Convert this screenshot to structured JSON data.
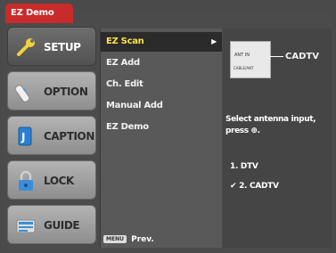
{
  "window": {
    "title": "EZ Demo"
  },
  "left_menu": {
    "items": [
      {
        "label": "SETUP",
        "icon": "wrench-icon",
        "active": true
      },
      {
        "label": "OPTION",
        "icon": "remote-icon",
        "active": false
      },
      {
        "label": "CAPTION",
        "icon": "caption-icon",
        "active": false
      },
      {
        "label": "LOCK",
        "icon": "padlock-icon",
        "active": false
      },
      {
        "label": "GUIDE",
        "icon": "guide-icon",
        "active": false
      }
    ]
  },
  "submenu": {
    "items": [
      {
        "label": "EZ Scan",
        "selected": true
      },
      {
        "label": "EZ Add",
        "selected": false
      },
      {
        "label": "Ch. Edit",
        "selected": false
      },
      {
        "label": "Manual Add",
        "selected": false
      },
      {
        "label": "EZ Demo",
        "selected": false
      }
    ],
    "arrow": "▶",
    "prev_key": "MENU",
    "prev_label": "Prev."
  },
  "info_panel": {
    "antenna_text_top": "ANT IN",
    "antenna_text_bottom": "CABLE/ANT",
    "antenna_label": "CADTV",
    "instruction": "Select antenna input, press ⊕.",
    "options": [
      {
        "label": "1. DTV",
        "checked": false
      },
      {
        "label": "✔ 2. CADTV",
        "checked": true
      }
    ]
  },
  "colors": {
    "title_red": "#c92a2a",
    "selected_text": "#ffe34a"
  }
}
